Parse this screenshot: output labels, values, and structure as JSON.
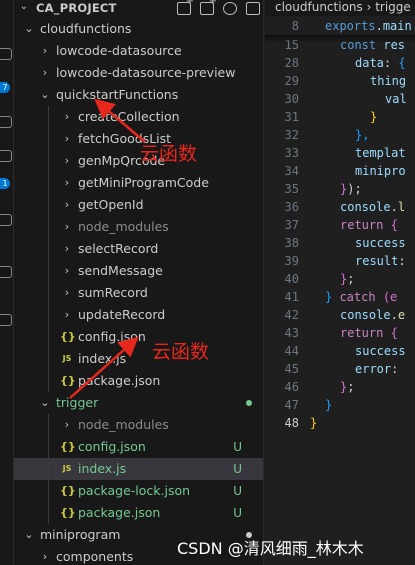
{
  "explorer": {
    "title": "CA_PROJECT",
    "header_actions": [
      "new-file-icon",
      "new-folder-icon",
      "refresh-icon",
      "collapse-all-icon"
    ],
    "items": [
      {
        "depth": 0,
        "kind": "folder",
        "open": true,
        "label": "cloudfunctions",
        "color": "#cccccc"
      },
      {
        "depth": 1,
        "kind": "folder",
        "open": false,
        "label": "lowcode-datasource",
        "color": "#cccccc"
      },
      {
        "depth": 1,
        "kind": "folder",
        "open": false,
        "label": "lowcode-datasource-preview",
        "color": "#cccccc"
      },
      {
        "depth": 1,
        "kind": "folder",
        "open": true,
        "label": "quickstartFunctions",
        "color": "#cccccc"
      },
      {
        "depth": 2,
        "kind": "folder",
        "open": false,
        "label": "createCollection",
        "color": "#cccccc"
      },
      {
        "depth": 2,
        "kind": "folder",
        "open": false,
        "label": "fetchGoodsList",
        "color": "#cccccc"
      },
      {
        "depth": 2,
        "kind": "folder",
        "open": false,
        "label": "genMpQrcode",
        "color": "#cccccc"
      },
      {
        "depth": 2,
        "kind": "folder",
        "open": false,
        "label": "getMiniProgramCode",
        "color": "#cccccc"
      },
      {
        "depth": 2,
        "kind": "folder",
        "open": false,
        "label": "getOpenId",
        "color": "#cccccc"
      },
      {
        "depth": 2,
        "kind": "folder",
        "open": false,
        "label": "node_modules",
        "color": "#8b8b8b"
      },
      {
        "depth": 2,
        "kind": "folder",
        "open": false,
        "label": "selectRecord",
        "color": "#cccccc"
      },
      {
        "depth": 2,
        "kind": "folder",
        "open": false,
        "label": "sendMessage",
        "color": "#cccccc"
      },
      {
        "depth": 2,
        "kind": "folder",
        "open": false,
        "label": "sumRecord",
        "color": "#cccccc"
      },
      {
        "depth": 2,
        "kind": "folder",
        "open": false,
        "label": "updateRecord",
        "color": "#cccccc"
      },
      {
        "depth": 2,
        "kind": "file",
        "icon": "{}",
        "label": "config.json",
        "color": "#cccccc"
      },
      {
        "depth": 2,
        "kind": "file",
        "icon": "JS",
        "label": "index.js",
        "color": "#cccccc"
      },
      {
        "depth": 2,
        "kind": "file",
        "icon": "{}",
        "label": "package.json",
        "color": "#cccccc"
      },
      {
        "depth": 1,
        "kind": "folder",
        "open": true,
        "label": "trigger",
        "color": "#73c991",
        "dot": true
      },
      {
        "depth": 2,
        "kind": "folder",
        "open": false,
        "label": "node_modules",
        "color": "#8b8b8b"
      },
      {
        "depth": 2,
        "kind": "file",
        "icon": "{}",
        "label": "config.json",
        "color": "#73c991",
        "status": "U"
      },
      {
        "depth": 2,
        "kind": "file",
        "icon": "JS",
        "label": "index.js",
        "color": "#73c991",
        "status": "U",
        "selected": true
      },
      {
        "depth": 2,
        "kind": "file",
        "icon": "{}",
        "label": "package-lock.json",
        "color": "#73c991",
        "status": "U"
      },
      {
        "depth": 2,
        "kind": "file",
        "icon": "{}",
        "label": "package.json",
        "color": "#73c991",
        "status": "U"
      },
      {
        "depth": 0,
        "kind": "folder",
        "open": true,
        "label": "miniprogram",
        "color": "#cccccc",
        "dot": true
      },
      {
        "depth": 1,
        "kind": "folder",
        "open": false,
        "label": "components",
        "color": "#cccccc"
      }
    ]
  },
  "editor": {
    "breadcrumb": "cloudfunctions › trigge",
    "sticky_lines": [
      {
        "n": "8",
        "tokens": [
          [
            "kw",
            "exports"
          ],
          [
            "plain",
            "."
          ],
          [
            "var",
            "main"
          ]
        ]
      }
    ],
    "lines": [
      {
        "n": "15",
        "indent": 2,
        "tokens": [
          [
            "kw",
            "const "
          ],
          [
            "var",
            "res"
          ]
        ]
      },
      {
        "n": "28",
        "indent": 3,
        "tokens": [
          [
            "var",
            "data"
          ],
          [
            "plain",
            ": "
          ],
          [
            "br3",
            "{"
          ]
        ]
      },
      {
        "n": "29",
        "indent": 4,
        "tokens": [
          [
            "var",
            "thing"
          ]
        ]
      },
      {
        "n": "30",
        "indent": 5,
        "tokens": [
          [
            "var",
            "val"
          ]
        ]
      },
      {
        "n": "31",
        "indent": 4,
        "tokens": [
          [
            "br1",
            "}"
          ]
        ]
      },
      {
        "n": "32",
        "indent": 3,
        "tokens": [
          [
            "br3",
            "},"
          ]
        ]
      },
      {
        "n": "33",
        "indent": 3,
        "tokens": [
          [
            "var",
            "templat"
          ]
        ]
      },
      {
        "n": "34",
        "indent": 3,
        "tokens": [
          [
            "var",
            "minipro"
          ]
        ]
      },
      {
        "n": "35",
        "indent": 2,
        "tokens": [
          [
            "br2",
            "}"
          ],
          [
            "plain",
            ");"
          ]
        ]
      },
      {
        "n": "36",
        "indent": 2,
        "tokens": [
          [
            "var",
            "console"
          ],
          [
            "plain",
            "."
          ],
          [
            "fn",
            "l"
          ]
        ]
      },
      {
        "n": "37",
        "indent": 2,
        "tokens": [
          [
            "ctl",
            "return "
          ],
          [
            "br2",
            "{"
          ]
        ]
      },
      {
        "n": "38",
        "indent": 3,
        "tokens": [
          [
            "var",
            "success"
          ]
        ]
      },
      {
        "n": "39",
        "indent": 3,
        "tokens": [
          [
            "var",
            "result"
          ],
          [
            "plain",
            ":"
          ]
        ]
      },
      {
        "n": "40",
        "indent": 2,
        "tokens": [
          [
            "br2",
            "}"
          ],
          [
            "plain",
            ";"
          ]
        ]
      },
      {
        "n": "41",
        "indent": 1,
        "tokens": [
          [
            "br3",
            "} "
          ],
          [
            "ctl",
            "catch "
          ],
          [
            "br2",
            "(e"
          ]
        ]
      },
      {
        "n": "42",
        "indent": 2,
        "tokens": [
          [
            "var",
            "console"
          ],
          [
            "plain",
            "."
          ],
          [
            "fn",
            "e"
          ]
        ]
      },
      {
        "n": "43",
        "indent": 2,
        "tokens": [
          [
            "ctl",
            "return "
          ],
          [
            "br2",
            "{"
          ]
        ]
      },
      {
        "n": "44",
        "indent": 3,
        "tokens": [
          [
            "var",
            "success"
          ]
        ]
      },
      {
        "n": "45",
        "indent": 3,
        "tokens": [
          [
            "var",
            "error"
          ],
          [
            "plain",
            ":"
          ]
        ]
      },
      {
        "n": "46",
        "indent": 2,
        "tokens": [
          [
            "br2",
            "}"
          ],
          [
            "plain",
            ";"
          ]
        ]
      },
      {
        "n": "47",
        "indent": 1,
        "tokens": [
          [
            "br3",
            "}"
          ]
        ]
      },
      {
        "n": "48",
        "indent": 0,
        "tokens": [
          [
            "br1",
            "}"
          ]
        ],
        "current": true
      }
    ]
  },
  "annotations": {
    "first": "云函数",
    "second": "云函数",
    "color": "#e8271c"
  },
  "watermark": "CSDN @清风细雨_林木木",
  "activity_badges": [
    "7",
    "1"
  ]
}
